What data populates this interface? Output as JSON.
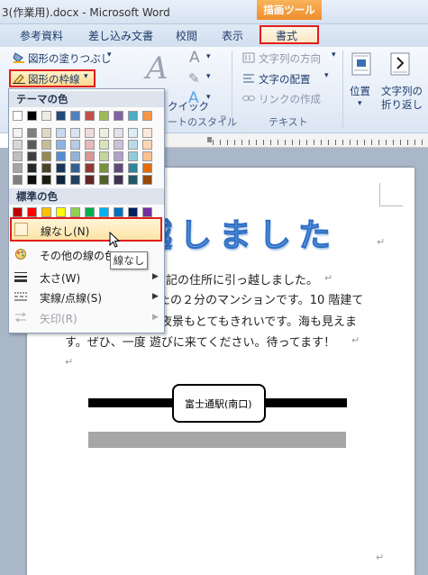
{
  "window": {
    "title": "3(作業用).docx - Microsoft Word",
    "context_tab_group": "描画ツール"
  },
  "tabs": [
    "参考資料",
    "差し込み文書",
    "校閲",
    "表示",
    "書式"
  ],
  "ribbon": {
    "fill_button": "図形の塗りつぶし",
    "outline_button": "図形の枠線",
    "wordart_style_label": "クイック",
    "wordart_group_label": "ートのスタイル",
    "text_direction": "文字列の方向",
    "text_align": "文字の配置",
    "create_link": "リンクの作成",
    "text_group_label": "テキスト",
    "position": "位置",
    "wrap_line1": "文字列の",
    "wrap_line2": "折り返し"
  },
  "menu": {
    "theme_colors_header": "テーマの色",
    "standard_colors_header": "標準の色",
    "no_line": "線なし(N)",
    "more_colors": "その他の線の色",
    "weight": "太さ(W)",
    "dashes": "実線/点線(S)",
    "arrows": "矢印(R)",
    "theme_top_row": [
      "#ffffff",
      "#000000",
      "#eeece1",
      "#1f497d",
      "#4f81bd",
      "#c0504d",
      "#9bbb59",
      "#8064a2",
      "#4bacc6",
      "#f79646"
    ],
    "theme_shades": [
      [
        "#f2f2f2",
        "#7f7f7f",
        "#ddd9c3",
        "#c6d9f0",
        "#dbe5f1",
        "#f2dcdb",
        "#ebf1dd",
        "#e5e0ec",
        "#dbeef3",
        "#fdeada"
      ],
      [
        "#d8d8d8",
        "#595959",
        "#c4bd97",
        "#8db3e2",
        "#b8cce4",
        "#e5b9b7",
        "#d7e3bc",
        "#ccc1d9",
        "#b7dde8",
        "#fbd5b5"
      ],
      [
        "#bfbfbf",
        "#3f3f3f",
        "#938953",
        "#548dd4",
        "#95b3d7",
        "#d99694",
        "#c3d69b",
        "#b2a2c7",
        "#92cddc",
        "#fac08f"
      ],
      [
        "#a5a5a5",
        "#262626",
        "#494429",
        "#17365d",
        "#366092",
        "#953734",
        "#76923c",
        "#5f497a",
        "#31859b",
        "#e36c09"
      ],
      [
        "#7f7f7f",
        "#0c0c0c",
        "#1d1b10",
        "#0f243e",
        "#244061",
        "#632423",
        "#4f6128",
        "#3f3151",
        "#205867",
        "#974806"
      ]
    ],
    "standard_colors": [
      "#c00000",
      "#ff0000",
      "#ffc000",
      "#ffff00",
      "#92d050",
      "#00b050",
      "#00b0f0",
      "#0070c0",
      "#002060",
      "#7030a0"
    ]
  },
  "tooltip": "線なし",
  "document": {
    "heading": "越しました",
    "lines": [
      "記の住所に引っ越しました。",
      "たの２分のマンションです。10 階建て",
      "夜景もとてもきれいです。海も見えま",
      "す。ぜひ、一度 遊びに来てください。待ってます！"
    ],
    "station_label": "富士通駅(南口)"
  }
}
